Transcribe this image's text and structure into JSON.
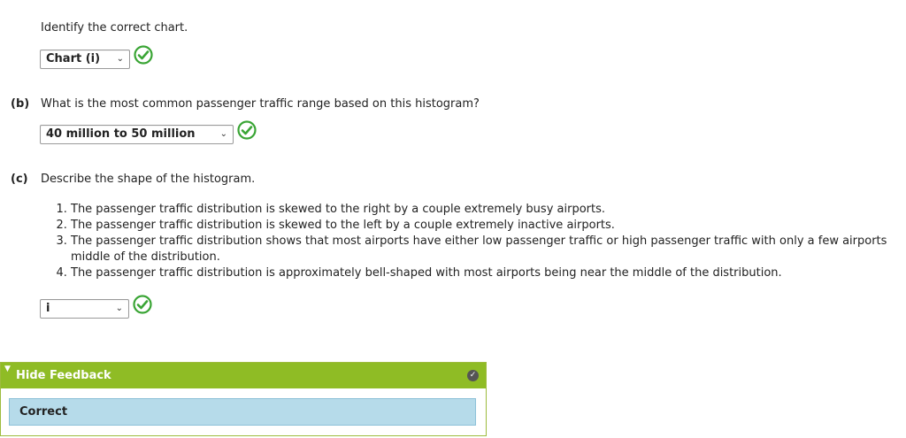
{
  "part_a": {
    "prompt": "Identify the correct chart.",
    "answer": "Chart (i)"
  },
  "part_b": {
    "label": "(b)",
    "question": "What is the most common passenger traffic range based on this histogram?",
    "answer": "40 million to 50 million"
  },
  "part_c": {
    "label": "(c)",
    "question": "Describe the shape of the histogram.",
    "choices": [
      "The passenger traffic distribution is skewed to the right by a couple extremely busy airports.",
      "The passenger traffic distribution is skewed to the left by a couple extremely inactive airports.",
      "The passenger traffic distribution shows that most airports have either low passenger traffic or high passenger traffic with only a few airports middle of the distribution.",
      "The passenger traffic distribution is approximately bell-shaped with most airports being near the middle of the distribution."
    ],
    "answer": "i"
  },
  "feedback": {
    "toggle_label": "Hide Feedback",
    "result": "Correct"
  },
  "icons": {
    "correct": "check-circle-icon",
    "dropdown": "chevron-down-icon"
  },
  "colors": {
    "check_green": "#3aa535",
    "feedback_header": "#8fbc25",
    "feedback_body": "#b6dbea"
  }
}
